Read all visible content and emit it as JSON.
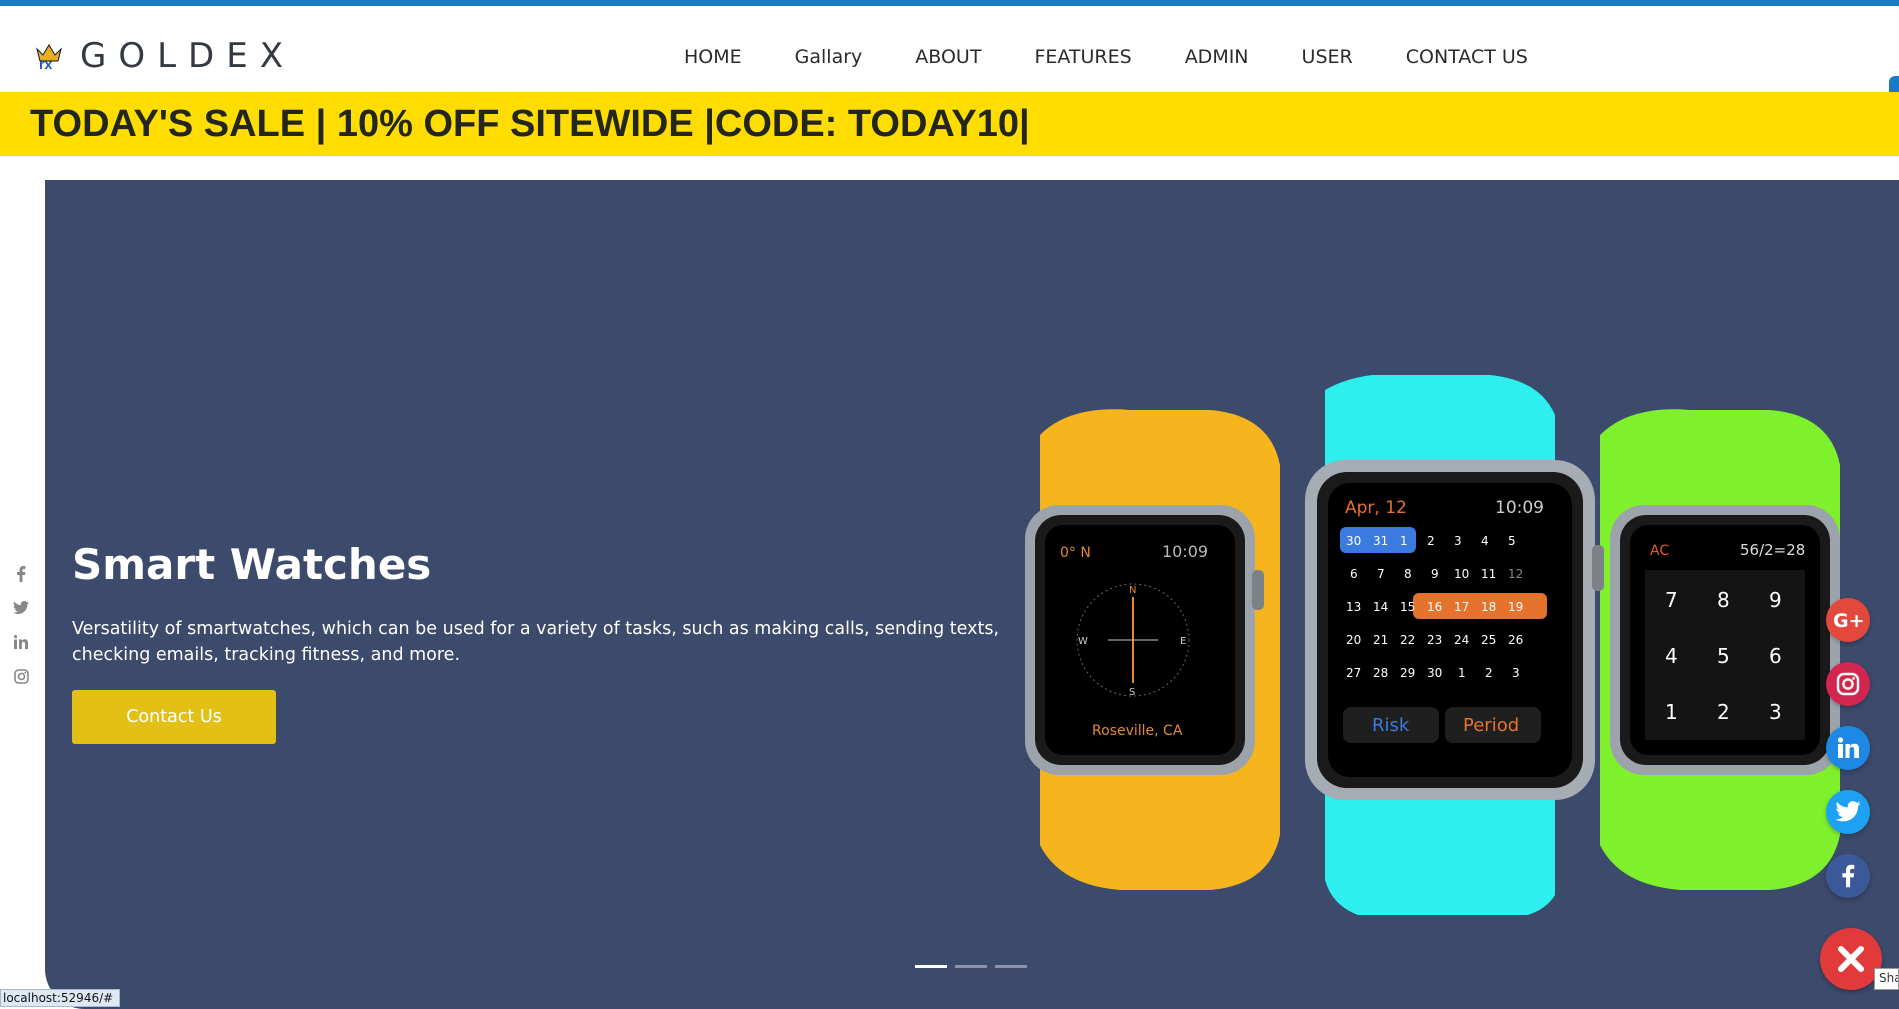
{
  "brand": {
    "name": "GOLDEX",
    "logo_letters": "rx"
  },
  "nav": {
    "items": [
      "HOME",
      "Gallary",
      "ABOUT",
      "FEATURES",
      "ADMIN",
      "USER",
      "CONTACT US"
    ]
  },
  "sale_banner": {
    "text": "TODAY'S SALE | 10% OFF SITEWIDE |CODE: TODAY10|"
  },
  "hero": {
    "title": "Smart Watches",
    "description": "Versatility of smartwatches, which can be used for a variety of tasks, such as making calls, sending texts, checking emails, tracking fitness, and more.",
    "cta_label": "Contact Us",
    "slides": 3,
    "active_slide": 1
  },
  "watch_yellow": {
    "heading": "0° N",
    "time": "10:09",
    "location": "Roseville, CA",
    "compass_n": "N",
    "compass_e": "E",
    "compass_s": "S",
    "compass_w": "W"
  },
  "watch_cyan": {
    "date": "Apr, 12",
    "time": "10:09",
    "calendar": [
      [
        "30",
        "31",
        "1",
        "2",
        "3",
        "4",
        "5"
      ],
      [
        "6",
        "7",
        "8",
        "9",
        "10",
        "11",
        "12"
      ],
      [
        "13",
        "14",
        "15",
        "16",
        "17",
        "18",
        "19"
      ],
      [
        "20",
        "21",
        "22",
        "23",
        "24",
        "25",
        "26"
      ],
      [
        "27",
        "28",
        "29",
        "30",
        "1",
        "2",
        "3"
      ]
    ],
    "risk_label": "Risk",
    "period_label": "Period"
  },
  "watch_green": {
    "clear": "AC",
    "display": "56/2=28",
    "keys": [
      "7",
      "8",
      "9",
      "4",
      "5",
      "6",
      "1",
      "2",
      "3"
    ]
  },
  "left_social": [
    "facebook-icon",
    "twitter-icon",
    "linkedin-icon",
    "instagram-icon"
  ],
  "floating_social": [
    {
      "name": "google-plus",
      "color": "#e2483b"
    },
    {
      "name": "instagram",
      "color": "#d3264e"
    },
    {
      "name": "linkedin",
      "color": "#1e88e5"
    },
    {
      "name": "twitter",
      "color": "#1da1f2"
    },
    {
      "name": "facebook",
      "color": "#3b5998"
    }
  ],
  "share_tooltip": "Share",
  "colors": {
    "accent_blue": "#1a7bc4",
    "sale_yellow": "#ffdd00",
    "hero_bg": "#3c4a6b",
    "cta_gold": "#e2c016",
    "close_red": "#e23a3a"
  },
  "status_bar": {
    "url": "localhost:52946/#"
  }
}
